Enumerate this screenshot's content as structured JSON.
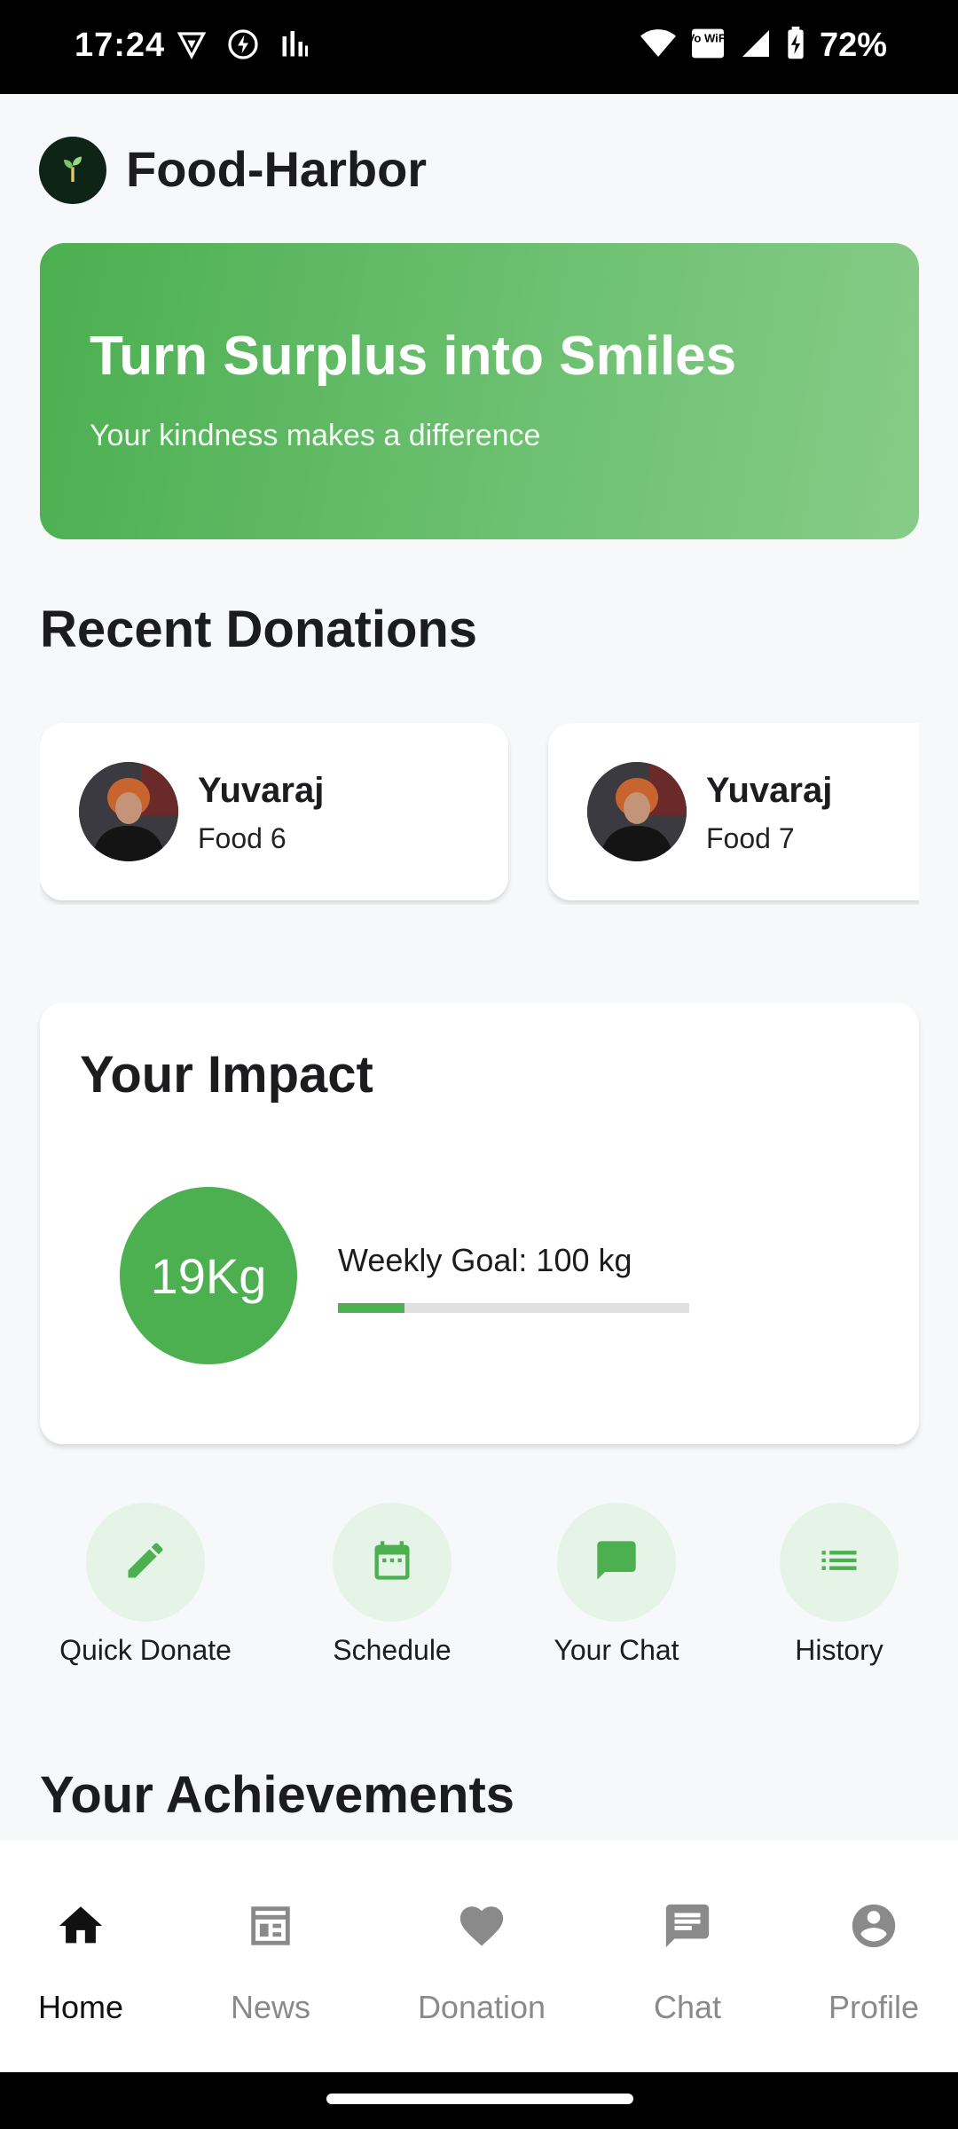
{
  "status_bar": {
    "time": "17:24",
    "battery_percent": "72%",
    "left_icons": [
      "vpn-shield-icon",
      "bolt-icon",
      "signal-bars-icon"
    ],
    "right_icons": [
      "wifi-icon",
      "vowifi-icon",
      "cell-signal-icon",
      "battery-charging-icon"
    ],
    "vowifi_text": "Vo WiFi"
  },
  "app": {
    "title": "Food-Harbor",
    "logo_icon": "sprout-icon",
    "accent_color": "#4caf50"
  },
  "banner": {
    "headline": "Turn Surplus into Smiles",
    "subtitle": "Your kindness makes a difference"
  },
  "recent_donations": {
    "title": "Recent Donations",
    "items": [
      {
        "name": "Yuvaraj",
        "item": "Food 6"
      },
      {
        "name": "Yuvaraj",
        "item": "Food 7"
      }
    ]
  },
  "impact": {
    "title": "Your Impact",
    "amount": "19Kg",
    "goal_label": "Weekly Goal: 100 kg",
    "progress_fraction": 0.19
  },
  "quick_actions": [
    {
      "label": "Quick Donate",
      "icon": "pencil-icon"
    },
    {
      "label": "Schedule",
      "icon": "calendar-icon"
    },
    {
      "label": "Your Chat",
      "icon": "chat-bubble-icon"
    },
    {
      "label": "History",
      "icon": "list-icon"
    }
  ],
  "achievements": {
    "title": "Your Achievements"
  },
  "bottom_nav": [
    {
      "label": "Home",
      "icon": "home-icon",
      "active": true
    },
    {
      "label": "News",
      "icon": "newspaper-icon",
      "active": false
    },
    {
      "label": "Donation",
      "icon": "heart-icon",
      "active": false
    },
    {
      "label": "Chat",
      "icon": "chat-icon",
      "active": false
    },
    {
      "label": "Profile",
      "icon": "account-circle-icon",
      "active": false
    }
  ]
}
